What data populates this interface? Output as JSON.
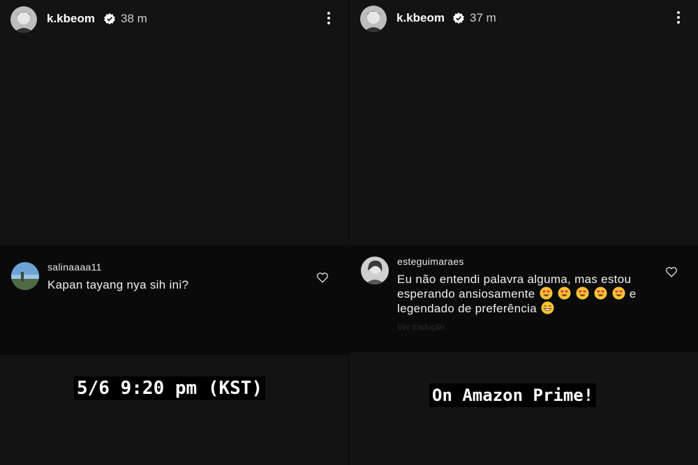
{
  "left": {
    "header": {
      "username": "k.kbeom",
      "time": "38 m"
    },
    "comment": {
      "username": "salinaaaa11",
      "text": "Kapan tayang nya sih ini?"
    },
    "caption": "5/6 9:20 pm (KST)"
  },
  "right": {
    "header": {
      "username": "k.kbeom",
      "time": "37 m"
    },
    "comment": {
      "username": "esteguimaraes",
      "line1": "Eu não entendi palavra alguma, mas estou",
      "line2": "esperando ansiosamente",
      "line2_end": "e",
      "line3": "legendado de preferência",
      "faded": "Ver tradução"
    },
    "caption": "On Amazon Prime!"
  },
  "icons": {
    "verified": "verified-badge-icon",
    "menu": "more-options-icon",
    "heart": "heart-outline-icon",
    "heart_eyes": "heart-eyes-emoji",
    "grin": "grinning-emoji"
  }
}
